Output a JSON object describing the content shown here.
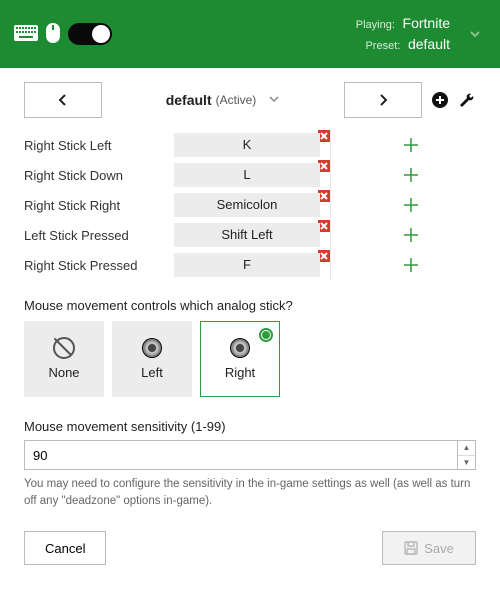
{
  "header": {
    "playing_label": "Playing:",
    "playing_value": "Fortnite",
    "preset_label": "Preset:",
    "preset_value": "default"
  },
  "preset_bar": {
    "name": "default",
    "status": "(Active)"
  },
  "mappings": [
    {
      "label": "Right Stick Left",
      "key": "K"
    },
    {
      "label": "Right Stick Down",
      "key": "L"
    },
    {
      "label": "Right Stick Right",
      "key": "Semicolon"
    },
    {
      "label": "Left Stick Pressed",
      "key": "Shift Left"
    },
    {
      "label": "Right Stick Pressed",
      "key": "F"
    }
  ],
  "mouse_section": {
    "question": "Mouse movement controls which analog stick?",
    "options": {
      "none": "None",
      "left": "Left",
      "right": "Right"
    },
    "selected": "right"
  },
  "sensitivity": {
    "label": "Mouse movement sensitivity (1-99)",
    "value": "90",
    "hint": "You may need to configure the sensitivity in the in-game settings as well (as well as turn off any \"deadzone\" options in-game)."
  },
  "footer": {
    "cancel": "Cancel",
    "save": "Save"
  }
}
